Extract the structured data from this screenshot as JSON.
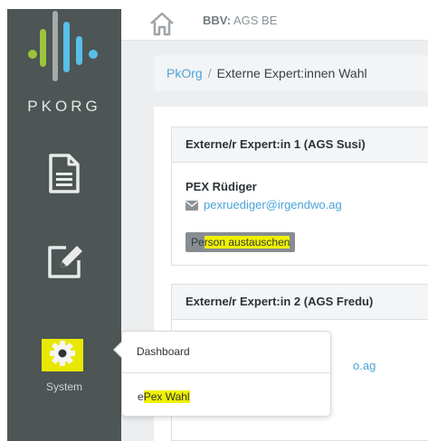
{
  "sidebar": {
    "logo_text": "PKORG",
    "items": [
      {
        "name": "document",
        "icon": "document-icon"
      },
      {
        "name": "edit",
        "icon": "edit-icon"
      },
      {
        "name": "system",
        "icon": "gear-icon",
        "label": "System"
      }
    ]
  },
  "header": {
    "bbv_label": "BBV:",
    "bbv_value": "AGS BE"
  },
  "breadcrumb": {
    "root": "PkOrg",
    "separator": "/",
    "current": "Externe Expert:innen Wahl"
  },
  "cards": [
    {
      "title": "Externe/r Expert:in 1 (AGS Susi)",
      "name": "PEX Rüdiger",
      "email": "pexruediger@irgendwo.ag",
      "button_pre": "Pe",
      "button_highlight": "rson austauschen"
    },
    {
      "title": "Externe/r Expert:in 2 (AGS Fredu)",
      "email_fragment": "o.ag"
    }
  ],
  "popover": {
    "items": [
      {
        "label": "Dashboard"
      },
      {
        "label_pre": "e",
        "label_highlight": "Pex Wahl"
      }
    ]
  },
  "colors": {
    "sidebar": "#4d5555",
    "accent": "#4aa3d8",
    "highlight": "#f0f000"
  }
}
